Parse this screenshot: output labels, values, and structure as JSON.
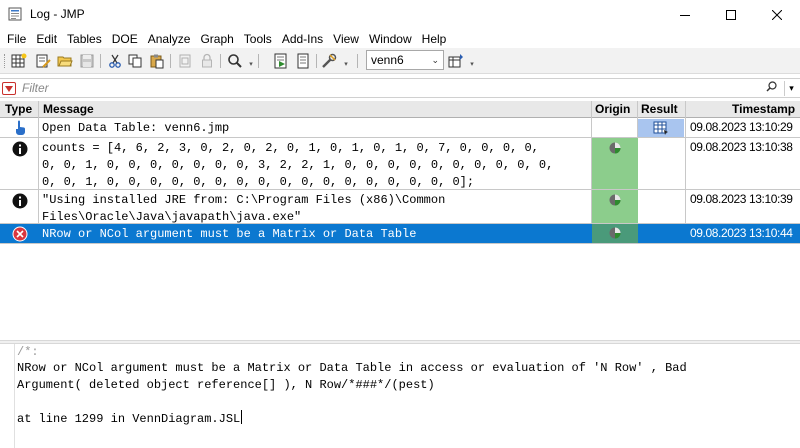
{
  "window": {
    "title": "Log - JMP",
    "icons": [
      "app-log-icon",
      "minimize-icon",
      "maximize-icon",
      "close-icon"
    ]
  },
  "menu": [
    "File",
    "Edit",
    "Tables",
    "DOE",
    "Analyze",
    "Graph",
    "Tools",
    "Add-Ins",
    "View",
    "Window",
    "Help"
  ],
  "toolbar": {
    "table_selector_value": "venn6",
    "icons": [
      "new-table-icon",
      "edit-icon",
      "open-icon",
      "save-icon",
      "cut-icon",
      "copy-icon",
      "paste-icon",
      "clipboard-icon",
      "lock-icon",
      "search-icon",
      "run-script-icon",
      "script-icon",
      "tools-icon",
      "table-icon"
    ]
  },
  "filter": {
    "placeholder": "Filter"
  },
  "log": {
    "columns": {
      "type": "Type",
      "message": "Message",
      "origin": "Origin",
      "result": "Result",
      "timestamp": "Timestamp"
    },
    "rows": [
      {
        "type": "action",
        "type_icon": "hand-pointer-icon",
        "message": "Open Data Table: venn6.jmp",
        "origin": false,
        "result": "data-table-icon",
        "timestamp": "09.08.2023 13:10:29",
        "selected": false
      },
      {
        "type": "info",
        "type_icon": "info-icon",
        "message": "counts = [4, 6, 2, 3, 0, 2, 0, 2, 0, 1, 0, 1, 0, 1, 0, 7, 0, 0, 0, 0,\n0, 0, 1, 0, 0, 0, 0, 0, 0, 0, 3, 2, 2, 1, 0, 0, 0, 0, 0, 0, 0, 0, 0, 0,\n0, 0, 1, 0, 0, 0, 0, 0, 0, 0, 0, 0, 0, 0, 0, 0, 0, 0, 0, 0];",
        "origin": true,
        "result": "",
        "timestamp": "09.08.2023 13:10:38",
        "selected": false
      },
      {
        "type": "info",
        "type_icon": "info-icon",
        "message": "\"Using installed JRE from: C:\\Program Files (x86)\\Common\nFiles\\Oracle\\Java\\javapath\\java.exe\"",
        "origin": true,
        "result": "",
        "timestamp": "09.08.2023 13:10:39",
        "selected": false
      },
      {
        "type": "error",
        "type_icon": "error-icon",
        "message": "NRow or NCol argument must be a Matrix or Data Table",
        "origin": true,
        "result": "",
        "timestamp": "09.08.2023 13:10:44",
        "selected": true
      }
    ]
  },
  "detail": {
    "comment": "/*:",
    "line1": "NRow or NCol argument must be a Matrix or Data Table in access or evaluation of 'N Row' , Bad",
    "line2": "Argument( deleted object reference[] ), N Row/*###*/(pest)",
    "line3": "at line 1299 in VennDiagram.JSL"
  },
  "colors": {
    "selected_row": "#0b78d0",
    "origin_cell": "#8ccd8c",
    "result_cell": "#a9c5ef",
    "error_icon": "#d9363e"
  }
}
